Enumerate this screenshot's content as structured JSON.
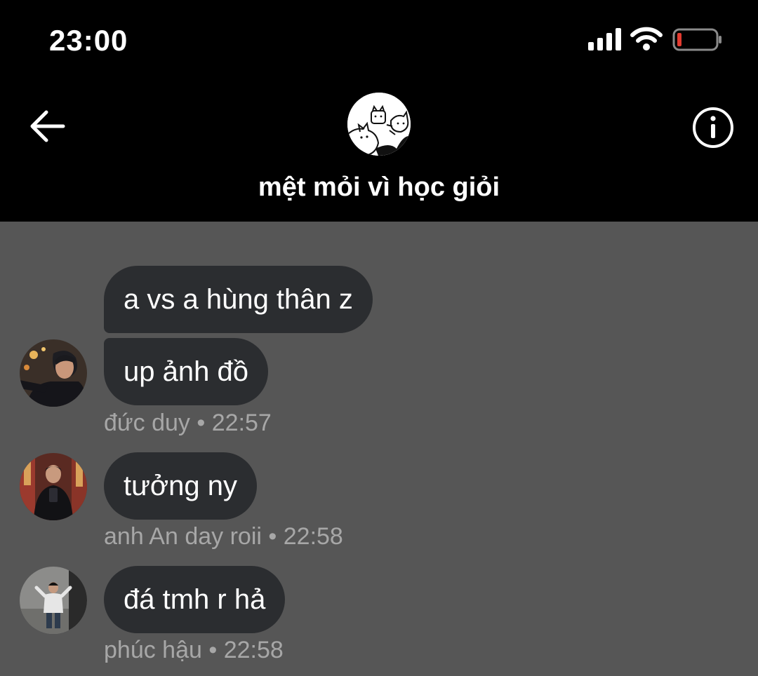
{
  "status_bar": {
    "time": "23:00",
    "icons": [
      "cellular-signal-icon",
      "wifi-icon",
      "battery-low-icon"
    ],
    "battery_color": "#e23b30"
  },
  "header": {
    "title": "mệt mỏi vì học giỏi",
    "back_icon": "arrow-left-icon",
    "info_icon": "info-circle-icon",
    "group_avatar": "cats-doodle-avatar"
  },
  "colors": {
    "background": "#565656",
    "header_bg": "#000000",
    "bubble_bg": "#2b2d30",
    "meta_text": "#a7a7a7"
  },
  "messages": [
    {
      "sender": "đức duy",
      "time": "22:57",
      "separator": "•",
      "texts": [
        "a vs a hùng thân z",
        "up ảnh đồ"
      ]
    },
    {
      "sender": "anh An day roii",
      "time": "22:58",
      "separator": "•",
      "texts": [
        "tưởng ny"
      ]
    },
    {
      "sender": "phúc hậu",
      "time": "22:58",
      "separator": "•",
      "texts": [
        "đá tmh r hả"
      ]
    }
  ]
}
